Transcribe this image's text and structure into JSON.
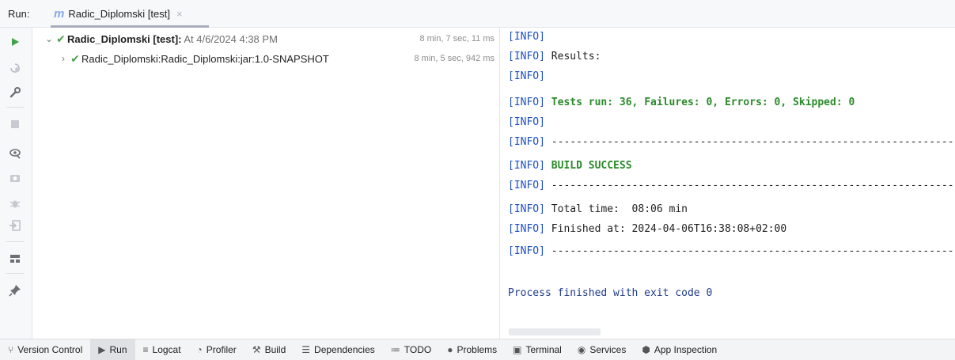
{
  "topbar": {
    "run_label": "Run:",
    "tab": {
      "icon_letter": "m",
      "title": "Radic_Diplomski [test]",
      "close": "×"
    }
  },
  "leftbar": {
    "icons": [
      "play-icon",
      "rerun-failed-icon",
      "wrench-icon",
      "stop-icon",
      "eye-icon",
      "camera-icon",
      "bug-icon",
      "import-icon",
      "layout-icon",
      "pin-icon"
    ]
  },
  "tree": {
    "rows": [
      {
        "chevron": "⌄",
        "name": "Radic_Diplomski [test]:",
        "suffix": " At 4/6/2024 4:38 PM",
        "time": "8 min, 7 sec, 11 ms"
      },
      {
        "chevron": "›",
        "name": "Radic_Diplomski:Radic_Diplomski:jar:1.0-SNAPSHOT",
        "suffix": "",
        "time": "8 min, 5 sec, 942 ms"
      }
    ]
  },
  "console": {
    "tag": "[INFO]",
    "lines": [
      {
        "tag": "[INFO]",
        "text": ""
      },
      {
        "tag": "[INFO]",
        "text": " Results:"
      },
      {
        "tag": "[INFO]",
        "text": ""
      },
      {
        "tag": "[INFO]",
        "text": " Tests run: 36, Failures: 0, Errors: 0, Skipped: 0"
      },
      {
        "tag": "[INFO]",
        "text": ""
      },
      {
        "tag": "[INFO]",
        "text": " ------------------------------------------------------------------------"
      },
      {
        "tag": "[INFO]",
        "text": " BUILD SUCCESS"
      },
      {
        "tag": "[INFO]",
        "text": " ------------------------------------------------------------------------"
      },
      {
        "tag": "[INFO]",
        "text": " Total time:  08:06 min"
      },
      {
        "tag": "[INFO]",
        "text": " Finished at: 2024-04-06T16:38:08+02:00"
      },
      {
        "tag": "[INFO]",
        "text": " ------------------------------------------------------------------------"
      }
    ],
    "exit_message": "Process finished with exit code 0"
  },
  "bottombar": {
    "items": [
      {
        "label": "Version Control",
        "icon": "version-control-icon"
      },
      {
        "label": "Run",
        "icon": "run-icon"
      },
      {
        "label": "Logcat",
        "icon": "logcat-icon"
      },
      {
        "label": "Profiler",
        "icon": "profiler-icon"
      },
      {
        "label": "Build",
        "icon": "build-icon"
      },
      {
        "label": "Dependencies",
        "icon": "dependencies-icon"
      },
      {
        "label": "TODO",
        "icon": "todo-icon"
      },
      {
        "label": "Problems",
        "icon": "problems-icon"
      },
      {
        "label": "Terminal",
        "icon": "terminal-icon"
      },
      {
        "label": "Services",
        "icon": "services-icon"
      },
      {
        "label": "App Inspection",
        "icon": "app-inspection-icon"
      }
    ]
  },
  "colors": {
    "info_tag": "#1d4fc2",
    "success_green": "#2a8a2a",
    "check_green": "#4fa14f",
    "exit_blue": "#1f3b8c"
  }
}
